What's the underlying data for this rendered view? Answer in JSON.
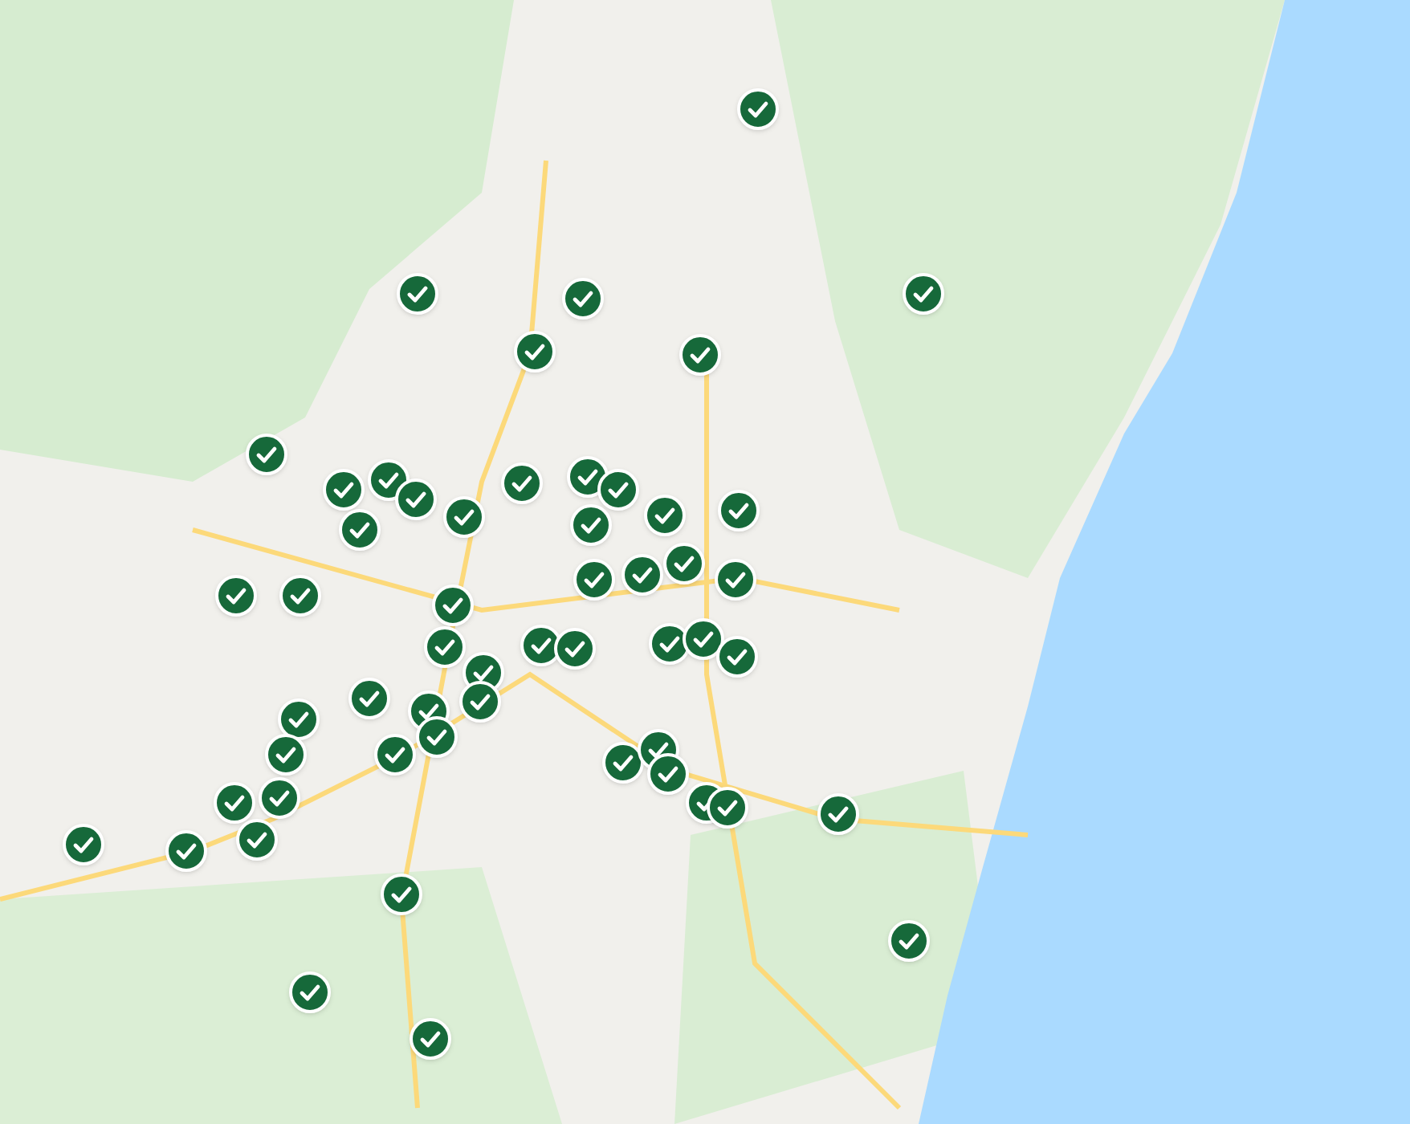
{
  "map": {
    "markers": [
      {
        "kind": "verified"
      },
      {
        "kind": "verified"
      },
      {
        "kind": "verified"
      },
      {
        "kind": "verified"
      },
      {
        "kind": "verified"
      },
      {
        "kind": "verified"
      },
      {
        "kind": "verified"
      },
      {
        "kind": "verified"
      },
      {
        "kind": "verified"
      },
      {
        "kind": "verified"
      },
      {
        "kind": "verified"
      },
      {
        "kind": "verified"
      },
      {
        "kind": "verified"
      },
      {
        "kind": "verified"
      },
      {
        "kind": "verified"
      },
      {
        "kind": "verified"
      },
      {
        "kind": "verified"
      },
      {
        "kind": "verified"
      },
      {
        "kind": "verified"
      },
      {
        "kind": "verified"
      },
      {
        "kind": "verified"
      },
      {
        "kind": "verified"
      },
      {
        "kind": "verified"
      },
      {
        "kind": "verified"
      },
      {
        "kind": "verified"
      },
      {
        "kind": "verified"
      },
      {
        "kind": "verified"
      },
      {
        "kind": "verified"
      },
      {
        "kind": "verified"
      },
      {
        "kind": "verified"
      },
      {
        "kind": "verified"
      },
      {
        "kind": "verified"
      },
      {
        "kind": "verified"
      },
      {
        "kind": "verified"
      },
      {
        "kind": "verified"
      },
      {
        "kind": "verified"
      },
      {
        "kind": "verified"
      },
      {
        "kind": "verified"
      },
      {
        "kind": "verified"
      },
      {
        "kind": "verified"
      },
      {
        "kind": "verified"
      },
      {
        "kind": "verified"
      },
      {
        "kind": "verified"
      },
      {
        "kind": "verified"
      },
      {
        "kind": "verified"
      },
      {
        "kind": "verified"
      },
      {
        "kind": "verified"
      },
      {
        "kind": "verified"
      },
      {
        "kind": "verified"
      },
      {
        "kind": "verified"
      },
      {
        "kind": "verified"
      },
      {
        "kind": "verified"
      },
      {
        "kind": "verified"
      },
      {
        "kind": "verified"
      }
    ]
  }
}
